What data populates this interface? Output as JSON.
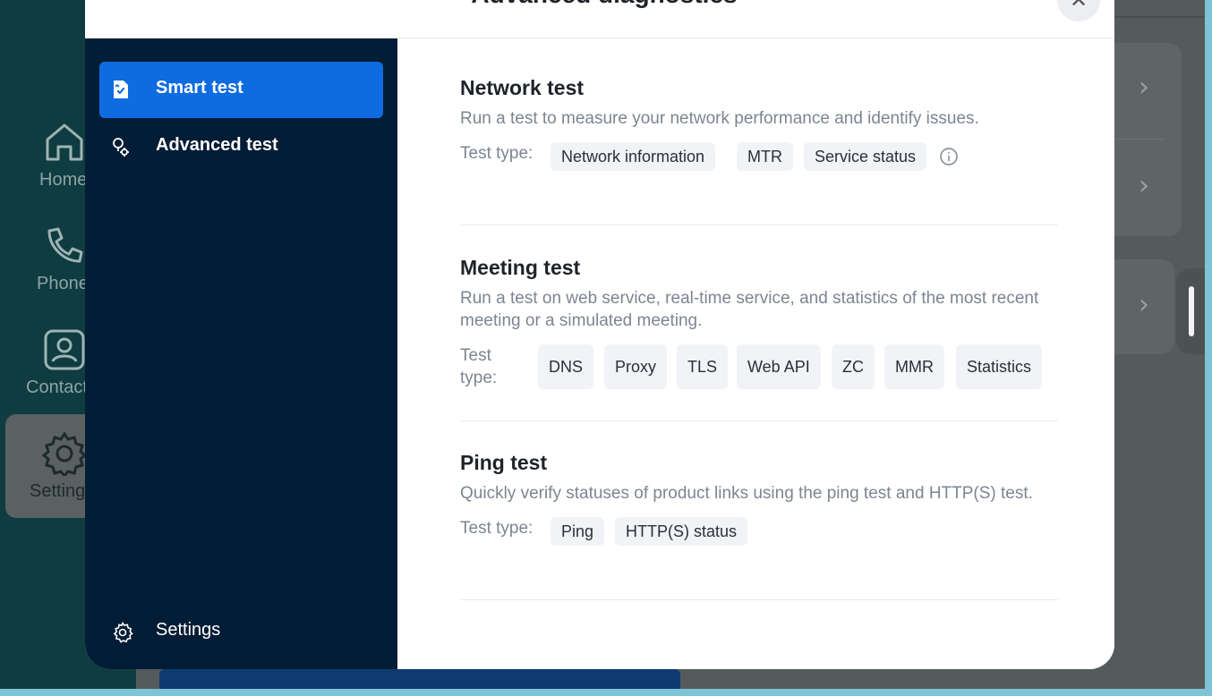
{
  "background_app": {
    "nav": [
      {
        "label": "Home",
        "icon": "home-icon"
      },
      {
        "label": "Phone",
        "icon": "phone-icon"
      },
      {
        "label": "Contacts",
        "icon": "contacts-icon"
      },
      {
        "label": "Settings",
        "icon": "gear-icon",
        "active": true
      }
    ]
  },
  "dialog": {
    "title": "Advanced diagnostics",
    "sidebar": {
      "items": [
        {
          "label": "Smart test",
          "icon": "smart-test-icon",
          "active": true
        },
        {
          "label": "Advanced test",
          "icon": "advanced-test-icon",
          "active": false
        }
      ],
      "settings_label": "Settings"
    },
    "sections": [
      {
        "title": "Network test",
        "description": "Run a test to measure your network performance and identify issues.",
        "test_type_label": "Test type:",
        "chips": [
          "Network information",
          "MTR",
          "Service status"
        ],
        "has_info_icon": true
      },
      {
        "title": "Meeting test",
        "description": "Run a test on web service, real-time service, and statistics of the most recent meeting or a simulated meeting.",
        "test_type_label": "Test type:",
        "chips": [
          "DNS",
          "Proxy",
          "TLS",
          "Web API",
          "ZC",
          "MMR",
          "Statistics"
        ]
      },
      {
        "title": "Ping test",
        "description": "Quickly verify statuses of product links using the ping test and HTTP(S) test.",
        "test_type_label": "Test type:",
        "chips": [
          "Ping",
          "HTTP(S) status"
        ]
      }
    ]
  },
  "colors": {
    "accent": "#0e6ce0",
    "sidebar_bg": "#041d36",
    "chip_bg": "#f1f3f6",
    "muted_text": "#7d8590"
  }
}
